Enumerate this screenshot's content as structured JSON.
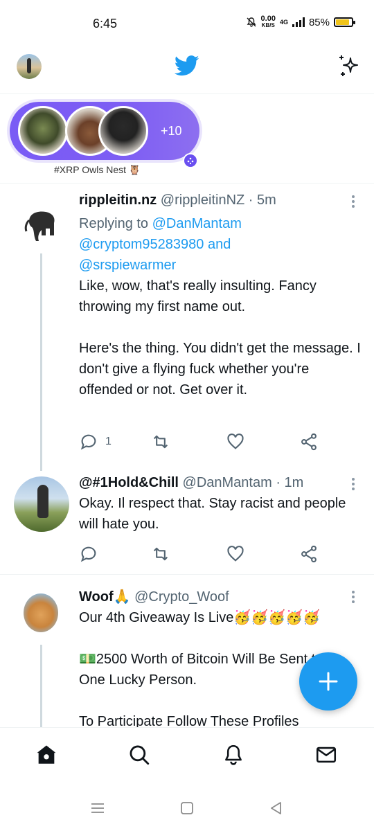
{
  "status_bar": {
    "time": "6:45",
    "net_speed": "0.00",
    "net_speed_unit": "KB/S",
    "network": "4G",
    "battery": "85%",
    "battery_level": 0.85
  },
  "fleets": {
    "more_count": "+10",
    "label": "#XRP Owls Nest 🦉"
  },
  "tweets": [
    {
      "name": "rippleitin.nz",
      "handle": "@rippleitinNZ",
      "time": "· 5m",
      "replying_prefix": "Replying to",
      "replying_to_1": "@DanMantam",
      "replying_to_2": "@cryptom95283980",
      "replying_and": "and",
      "replying_to_3": "@srspiewarmer",
      "paragraph_1": "Like, wow, that's really insulting. Fancy throwing my first name out.",
      "paragraph_2": "Here's the thing. You didn't get the message. I don't give a flying fuck whether you're offended or not. Get over it.",
      "reply_count": "1"
    },
    {
      "name": "@#1Hold&Chill",
      "handle": "@DanMantam",
      "time": "· 1m",
      "paragraph_1": "Okay. Il respect that. Stay racist and people will hate you."
    },
    {
      "name": "Woof🙏",
      "handle": "@Crypto_Woof",
      "paragraph_1": "Our 4th Giveaway Is Live🥳🥳🥳🥳🥳",
      "paragraph_2": "💵2500 Worth of Bitcoin Will Be Sent to a One Lucky Person.",
      "paragraph_3": "To Participate Follow These Profiles"
    }
  ],
  "colors": {
    "accent": "#1d9bf0",
    "fleet_purple": "#7a5cf5"
  },
  "icons": {
    "top_left": "profile-avatar",
    "top_center": "twitter-bird-icon",
    "top_right": "sparkle-icon",
    "fab": "plus-icon",
    "bottom_nav": [
      "home-icon",
      "search-icon",
      "bell-icon",
      "mail-icon"
    ],
    "system_nav": [
      "menu-icon",
      "square-icon",
      "back-icon"
    ]
  }
}
